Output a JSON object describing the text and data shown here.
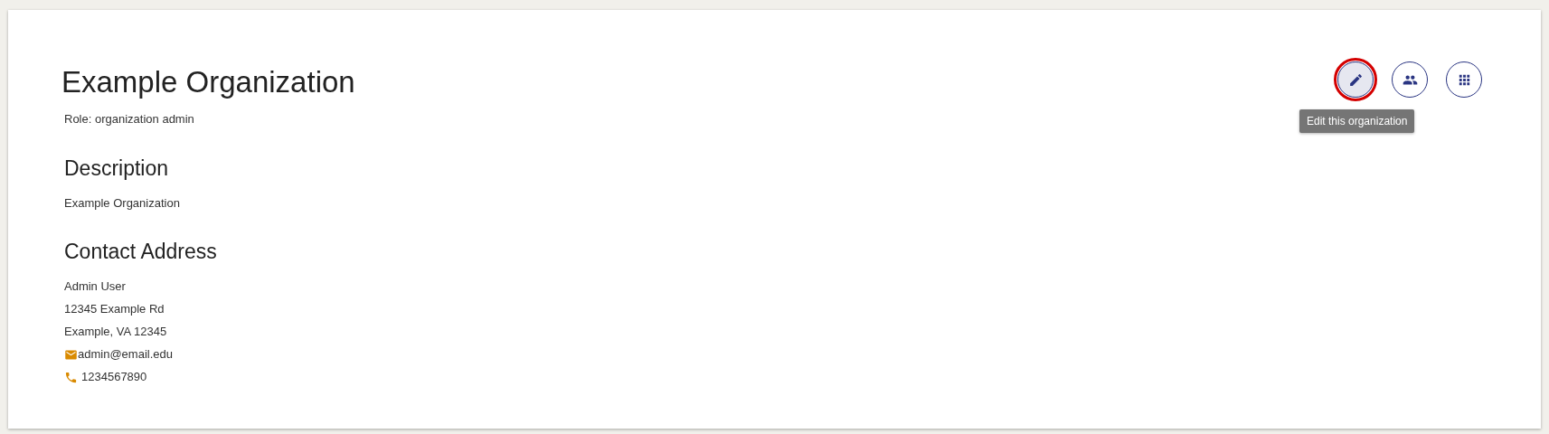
{
  "organization": {
    "title": "Example Organization",
    "role": "Role: organization admin"
  },
  "actions": [
    {
      "kind": "pencil",
      "focused": true,
      "tooltip": "Edit this organization"
    },
    {
      "kind": "people",
      "focused": false
    },
    {
      "kind": "grid",
      "focused": false
    }
  ],
  "sections": [
    {
      "heading": "Description",
      "lines": [
        {
          "kind": "text",
          "text": "Example Organization"
        }
      ]
    },
    {
      "heading": "Contact Address",
      "lines": [
        {
          "kind": "text",
          "text": "Admin User"
        },
        {
          "kind": "text",
          "text": "12345 Example Rd"
        },
        {
          "kind": "text",
          "text": "Example, VA 12345"
        },
        {
          "kind": "email",
          "text": "admin@email.edu"
        },
        {
          "kind": "phone",
          "text": "1234567890"
        }
      ]
    }
  ]
}
